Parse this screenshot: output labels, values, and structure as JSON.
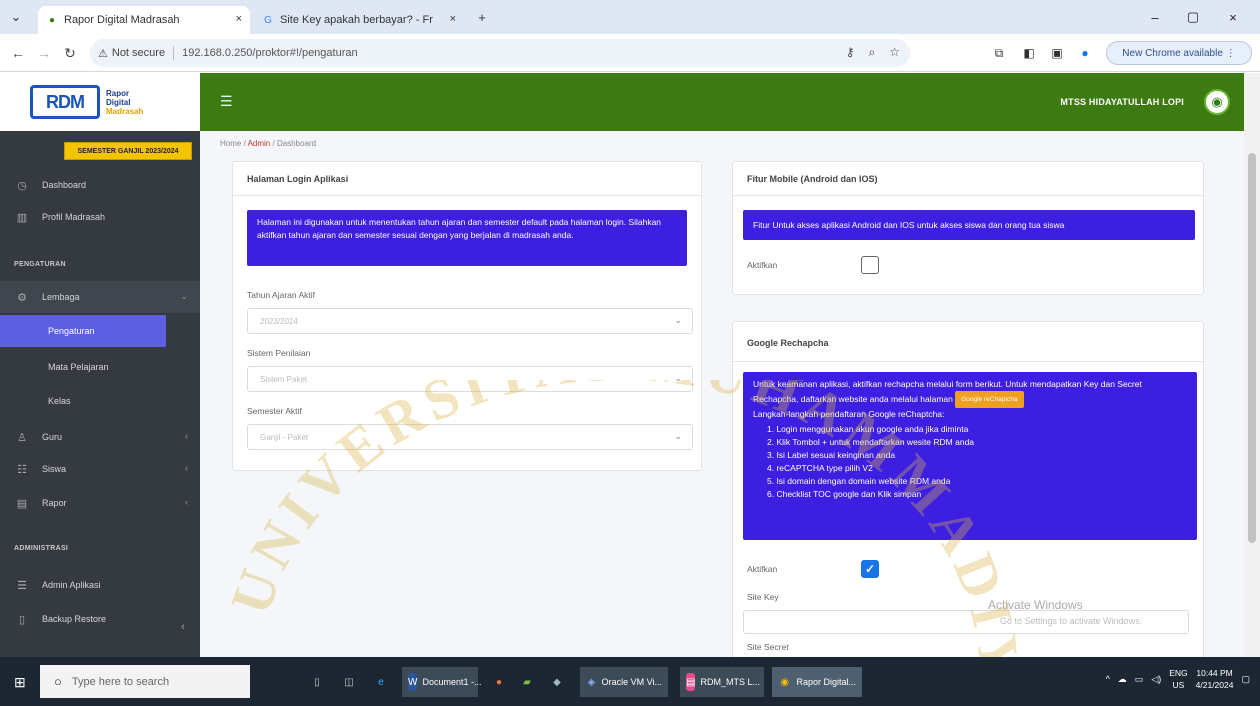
{
  "browser": {
    "tabs": [
      {
        "title": "Rapor Digital Madrasah",
        "close": "×"
      },
      {
        "title": "Site Key apakah berbayar? - Fr",
        "close": "×"
      }
    ],
    "new_tab": "+",
    "address": "192.168.0.250/proktor#!/pengaturan",
    "security": "Not secure",
    "new_chrome": "New Chrome available",
    "window_controls": [
      "–",
      "▢",
      "×"
    ]
  },
  "header": {
    "logo_big": "RDM",
    "logo_lines": [
      "Rapor",
      "Digital",
      "Madrasah"
    ],
    "school": "MTSS HIDAYATULLAH LOPI"
  },
  "sidebar": {
    "semester": "SEMESTER GANJIL 2023/2024",
    "items": [
      {
        "label": "Dashboard",
        "icon": "dashboard-icon"
      },
      {
        "label": "Profil Madrasah",
        "icon": "building-icon"
      }
    ],
    "section_pengaturan": "PENGATURAN",
    "lembaga": "Lembaga",
    "pengaturan": "Pengaturan",
    "mata_pelajaran": "Mata Pelajaran",
    "kelas": "Kelas",
    "guru": "Guru",
    "siswa": "Siswa",
    "rapor": "Rapor",
    "section_admin": "ADMINISTRASI",
    "admin_aplikasi": "Admin Aplikasi",
    "backup": "Backup Restore"
  },
  "breadcrumb": {
    "home": "Home",
    "admin": "Admin",
    "current": "Dashboard"
  },
  "login_card": {
    "title": "Halaman Login Aplikasi",
    "alert": "Halaman ini digunakan untuk menentukan tahun ajaran dan semester default pada halaman login. Silahkan aktifkan tahun ajaran dan semester sesuai dengan yang berjalan di madrasah anda.",
    "tahun_label": "Tahun Ajaran Aktif",
    "tahun_value": "2023/2024",
    "sistem_label": "Sistem Penilaian",
    "sistem_value": "Sistem Paket",
    "semester_label": "Semester Aktif",
    "semester_value": "Ganjil - Paket"
  },
  "mobile_card": {
    "title": "Fitur Mobile (Android dan IOS)",
    "alert": "Fitur Untuk akses aplikasi Android dan IOS untuk akses siswa dan orang tua siswa",
    "aktifkan": "Aktifkan"
  },
  "recaptcha_card": {
    "title": "Google Rechapcha",
    "alert_intro": "Untuk keamanan aplikasi, aktifkan rechapcha melalui form berikut. Untuk mendapatkan Key dan Secret Rechapcha, daftarkan website anda melalui halaman",
    "alert_button": "Google reChaptcha",
    "steps_title": "Langkah-langkah pendaftaran Google reChaptcha:",
    "steps": [
      "1. Login menggunakan akun google anda jika diminta",
      "2. Klik Tombol + untuk mendaftarkan wesite RDM anda",
      "3. Isi Label sesuai keinginan anda",
      "4. reCAPTCHA type pilih V2",
      "5. Isi domain dengan domain website RDM anda",
      "6. Checklist TOC google dan Klik simpan"
    ],
    "aktifkan": "Aktifkan",
    "site_key": "Site Key",
    "site_secret": "Site Secret"
  },
  "watermark": {
    "text": "UNIVERSITAS MUHAMMADIYAH MAKASSAR",
    "activate": "Activate Windows",
    "activate_sub": "Go to Settings to activate Windows."
  },
  "taskbar": {
    "search": "Type here to search",
    "apps": [
      "Document1 -...",
      "Oracle VM Vi...",
      "RDM_MTS L...",
      "Rapor Digital..."
    ],
    "lang": "ENG",
    "lang_sub": "US",
    "time": "10:44 PM",
    "date": "4/21/2024"
  }
}
